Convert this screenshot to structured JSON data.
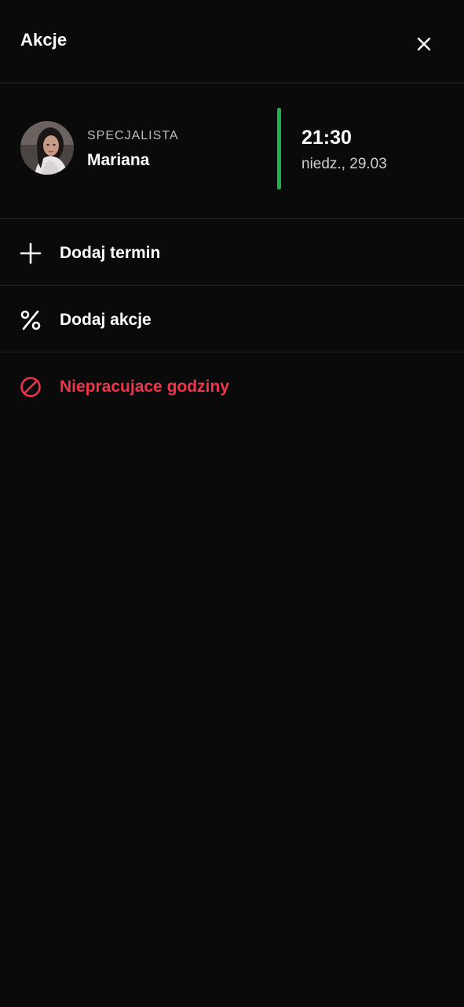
{
  "header": {
    "title": "Akcje",
    "close_icon": "close-icon"
  },
  "specialist": {
    "role": "SPECJALISTA",
    "name": "Mariana",
    "avatar": "avatar-photo"
  },
  "appointment": {
    "time": "21:30",
    "date": "niedz., 29.03",
    "status_color": "#1db34a"
  },
  "menu": [
    {
      "label": "Dodaj termin",
      "icon": "plus-icon",
      "color": "#ffffff"
    },
    {
      "label": "Dodaj akcje",
      "icon": "percent-icon",
      "color": "#ffffff"
    },
    {
      "label": "Niepracujace godziny",
      "icon": "block-icon",
      "color": "#f0344a"
    }
  ],
  "colors": {
    "background": "#0a0a0a",
    "divider": "#262626",
    "accent_green": "#1db34a",
    "danger_red": "#f0344a"
  }
}
